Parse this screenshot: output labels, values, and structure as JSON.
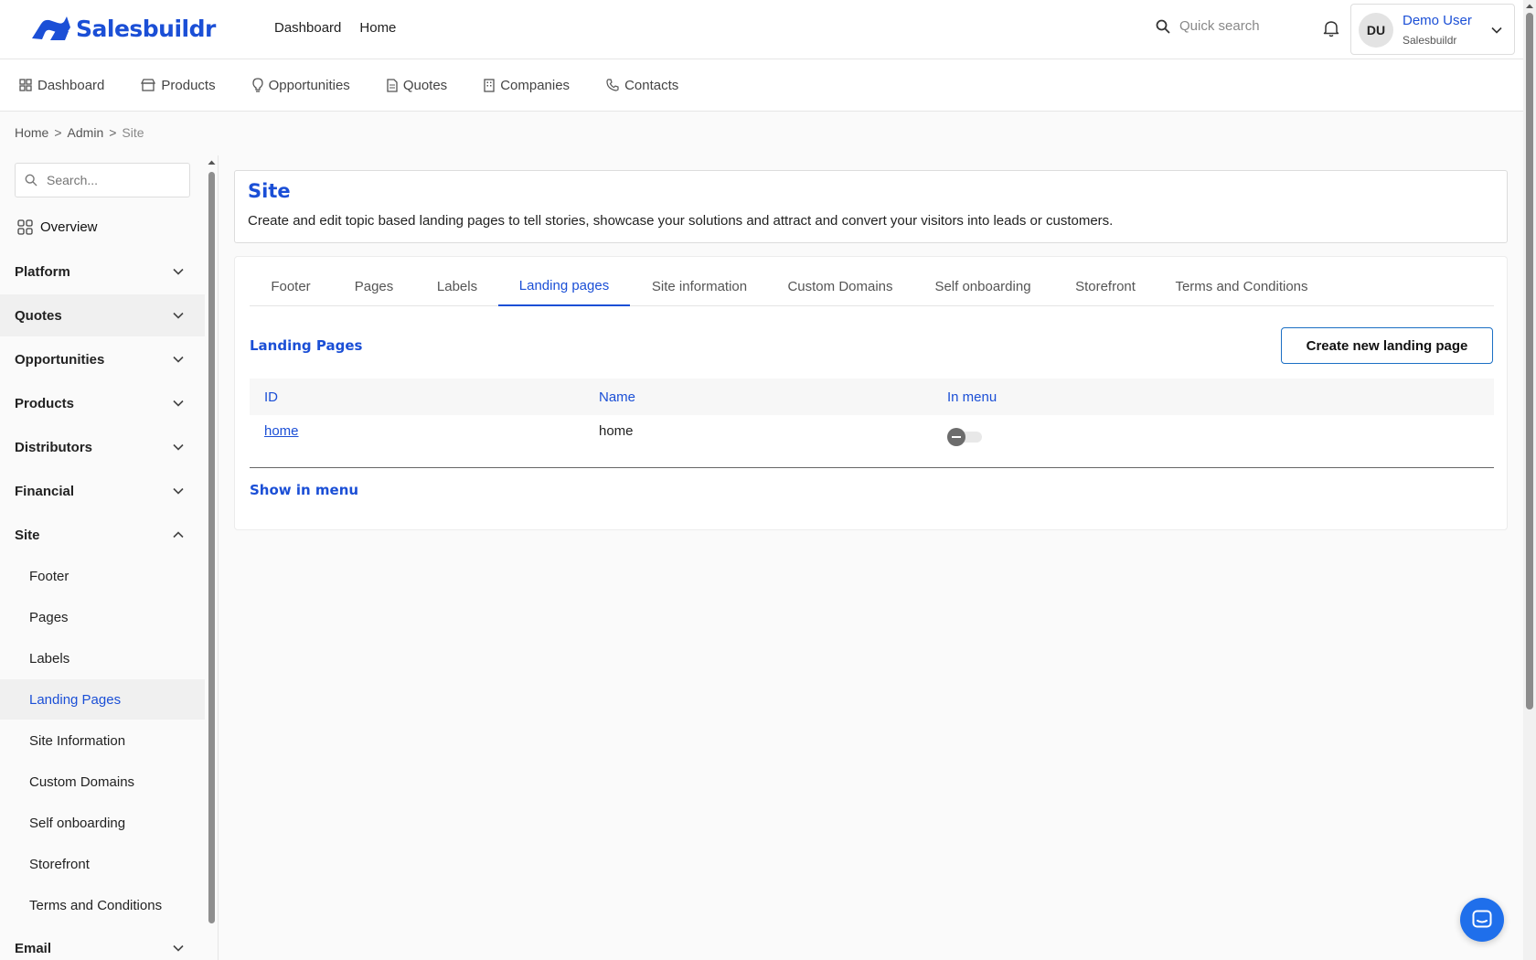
{
  "brand": {
    "name": "Salesbuildr",
    "color": "#1b4fd6"
  },
  "topnav": {
    "items": [
      "Dashboard",
      "Home"
    ]
  },
  "search": {
    "placeholder": "Quick search"
  },
  "user": {
    "initials": "DU",
    "name": "Demo User",
    "org": "Salesbuildr"
  },
  "modnav": {
    "items": [
      {
        "label": "Dashboard",
        "icon": "grid-icon"
      },
      {
        "label": "Products",
        "icon": "store-icon"
      },
      {
        "label": "Opportunities",
        "icon": "lightbulb-icon"
      },
      {
        "label": "Quotes",
        "icon": "document-icon"
      },
      {
        "label": "Companies",
        "icon": "building-icon"
      },
      {
        "label": "Contacts",
        "icon": "phone-icon"
      }
    ]
  },
  "breadcrumb": {
    "items": [
      "Home",
      "Admin",
      "Site"
    ],
    "separator": ">"
  },
  "sidebar": {
    "search_placeholder": "Search...",
    "overview": "Overview",
    "groups": [
      "Platform",
      "Quotes",
      "Opportunities",
      "Products",
      "Distributors",
      "Financial",
      "Site",
      "Email"
    ],
    "site_items": [
      "Footer",
      "Pages",
      "Labels",
      "Landing Pages",
      "Site Information",
      "Custom Domains",
      "Self onboarding",
      "Storefront",
      "Terms and Conditions"
    ],
    "active_item": "Landing Pages"
  },
  "header": {
    "title": "Site",
    "description": "Create and edit topic based landing pages to tell stories, showcase your solutions and attract and convert your visitors into leads or customers."
  },
  "tabs": [
    "Footer",
    "Pages",
    "Labels",
    "Landing pages",
    "Site information",
    "Custom Domains",
    "Self onboarding",
    "Storefront",
    "Terms and Conditions"
  ],
  "active_tab": "Landing pages",
  "landing": {
    "title": "Landing Pages",
    "create_label": "Create new landing page",
    "columns": [
      "ID",
      "Name",
      "In menu"
    ],
    "rows": [
      {
        "id": "home",
        "name": "home",
        "in_menu": false
      }
    ],
    "show_in_menu": "Show in menu"
  }
}
